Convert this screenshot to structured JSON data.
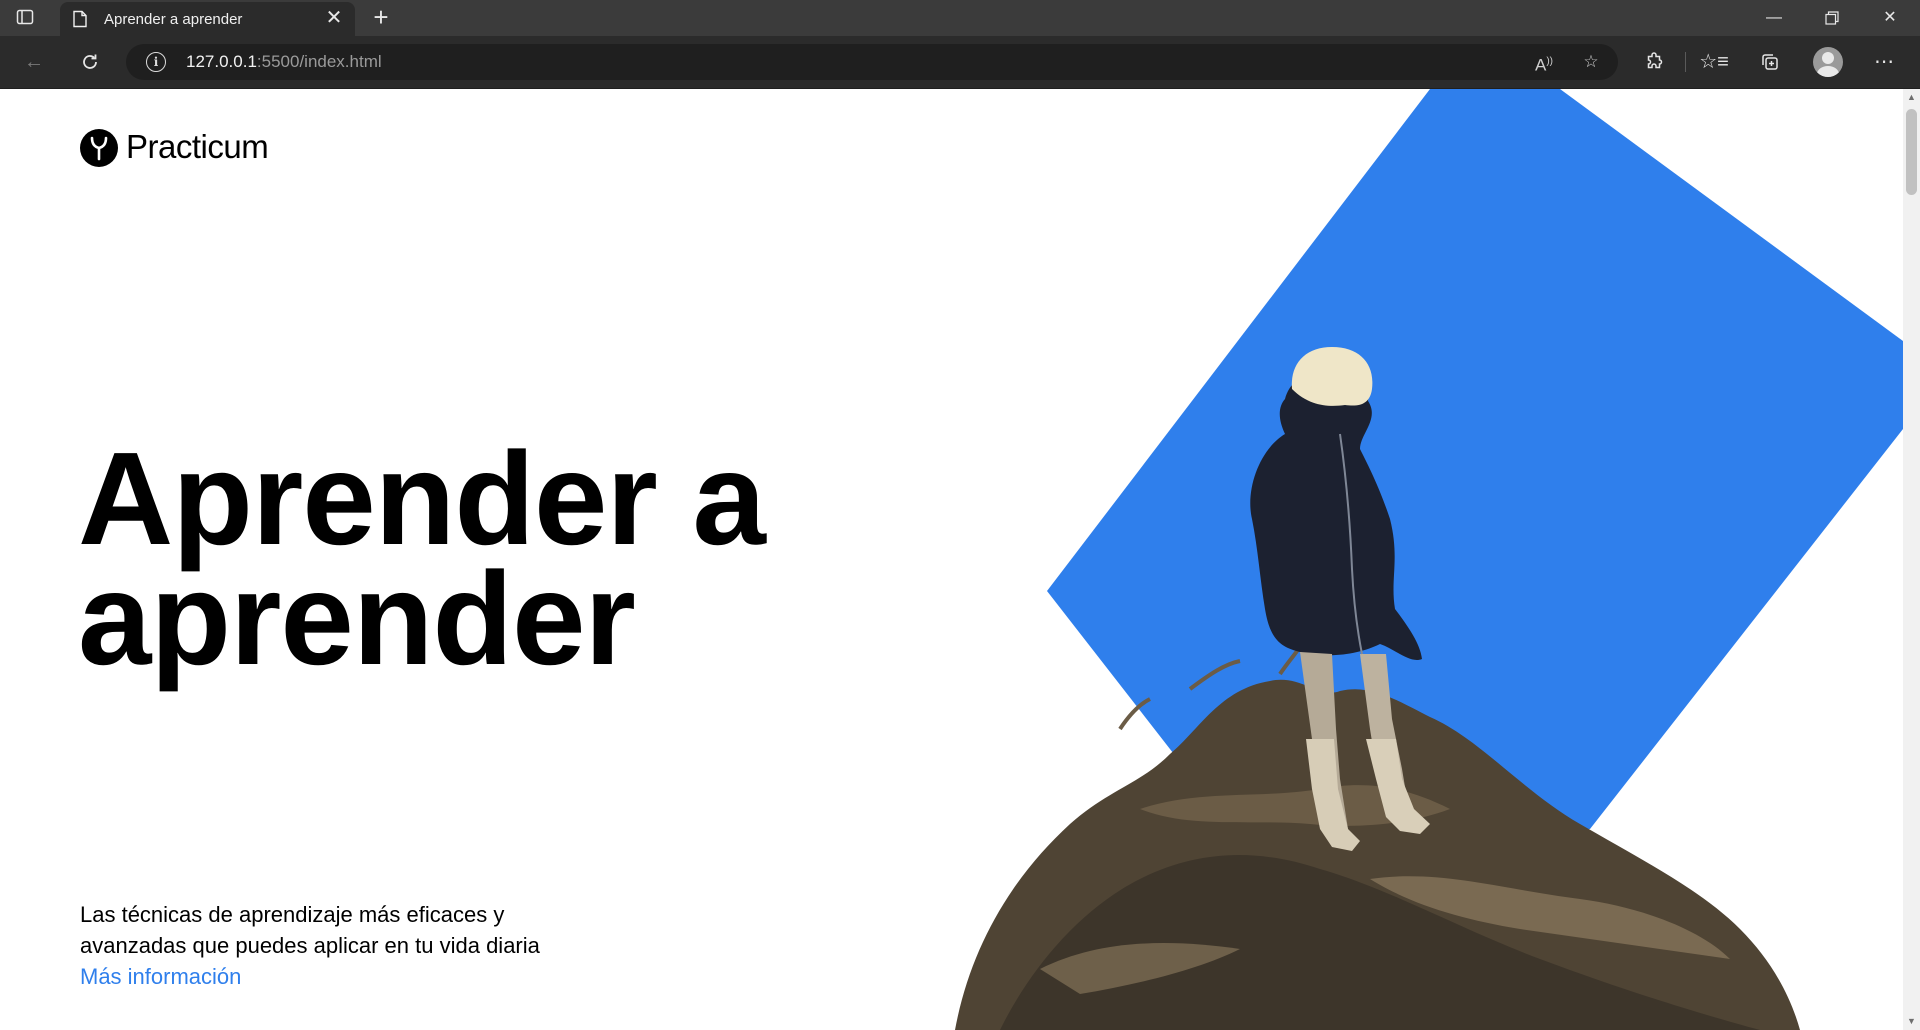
{
  "browser": {
    "tab_title": "Aprender a aprender",
    "url_host": "127.0.0.1",
    "url_rest": ":5500/index.html",
    "window_controls": [
      "minimize-icon",
      "restore-icon",
      "close-icon"
    ],
    "toolbar_icons": [
      "back-icon",
      "refresh-icon",
      "read-aloud-icon",
      "add-favorite-icon",
      "extensions-icon",
      "favorites-icon",
      "collections-icon",
      "profile-icon",
      "more-icon"
    ]
  },
  "page": {
    "logo_text": "Practicum",
    "hero_title": "Aprender a aprender",
    "description": "Las técnicas de aprendizaje más eficaces y avanzadas que puedes aplicar en tu vida diaria",
    "link_text": "Más información"
  },
  "colors": {
    "accent_blue": "#2f7fec",
    "chrome_dark": "#2b2b2b",
    "tabbar": "#3b3b3b"
  }
}
